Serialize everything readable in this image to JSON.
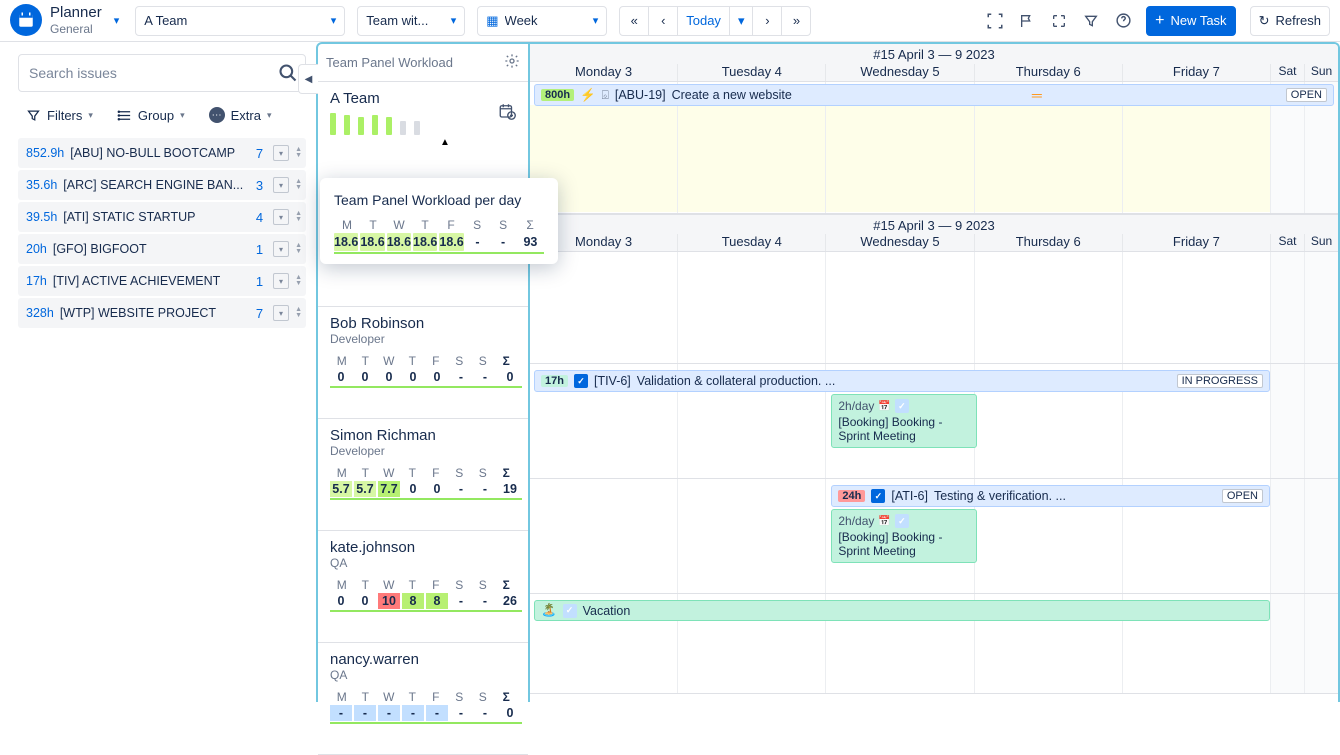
{
  "brand": {
    "title": "Planner",
    "subtitle": "General"
  },
  "toolbar": {
    "team_select": "A Team",
    "mode_select": "Team wit...",
    "range_select": "Week",
    "today": "Today",
    "new_task": "New Task",
    "refresh": "Refresh"
  },
  "search": {
    "placeholder": "Search issues"
  },
  "filters": {
    "filters": "Filters",
    "group": "Group",
    "extra": "Extra"
  },
  "projects": [
    {
      "h": "852.9h",
      "name": "[ABU] NO-BULL BOOTCAMP",
      "count": "7"
    },
    {
      "h": "35.6h",
      "name": "[ARC] SEARCH ENGINE BAN...",
      "count": "3"
    },
    {
      "h": "39.5h",
      "name": "[ATI] STATIC STARTUP",
      "count": "4"
    },
    {
      "h": "20h",
      "name": "[GFO] BIGFOOT",
      "count": "1"
    },
    {
      "h": "17h",
      "name": "[TIV] ACTIVE ACHIEVEMENT",
      "count": "1"
    },
    {
      "h": "328h",
      "name": "[WTP] WEBSITE PROJECT",
      "count": "7"
    }
  ],
  "panel": {
    "title": "Team Panel Workload",
    "team": "A Team",
    "tooltip_title": "Team Panel Workload per day",
    "days": [
      "M",
      "T",
      "W",
      "T",
      "F",
      "S",
      "S",
      "Σ"
    ],
    "team_vals": [
      "18.6",
      "18.6",
      "18.6",
      "18.6",
      "18.6",
      "-",
      "-",
      "93"
    ],
    "users": [
      {
        "name": "Bob Robinson",
        "role": "Developer",
        "vals": [
          "0",
          "0",
          "0",
          "0",
          "0",
          "-",
          "-",
          "0"
        ],
        "classes": [
          "",
          "",
          "",
          "",
          "",
          "",
          "",
          ""
        ]
      },
      {
        "name": "Simon Richman",
        "role": "Developer",
        "vals": [
          "5.7",
          "5.7",
          "7.7",
          "0",
          "0",
          "-",
          "-",
          "19"
        ],
        "classes": [
          "g",
          "g",
          "g2",
          "",
          "",
          "",
          "",
          ""
        ]
      },
      {
        "name": "kate.johnson",
        "role": "QA",
        "vals": [
          "0",
          "0",
          "10",
          "8",
          "8",
          "-",
          "-",
          "26"
        ],
        "classes": [
          "",
          "",
          "r",
          "g2",
          "g2",
          "",
          "",
          ""
        ]
      },
      {
        "name": "nancy.warren",
        "role": "QA",
        "vals": [
          "-",
          "-",
          "-",
          "-",
          "-",
          "-",
          "-",
          "0"
        ],
        "classes": [
          "b",
          "b",
          "b",
          "b",
          "b",
          "",
          "",
          ""
        ]
      }
    ]
  },
  "calendar": {
    "week_label": "#15 April 3 — 9 2023",
    "days": [
      "Monday 3",
      "Tuesday 4",
      "Wednesday 5",
      "Thursday 6",
      "Friday 7",
      "Sat",
      "Sun"
    ],
    "task1": {
      "h": "800h",
      "key": "[ABU-19]",
      "title": "Create a new website",
      "status": "OPEN"
    },
    "task2": {
      "h": "17h",
      "key": "[TIV-6]",
      "title": "Validation & collateral production. ...",
      "status": "IN PROGRESS"
    },
    "task3": {
      "h": "24h",
      "key": "[ATI-6]",
      "title": "Testing & verification. ...",
      "status": "OPEN"
    },
    "booking": {
      "h": "2h/day",
      "title": "[Booking] Booking - Sprint Meeting"
    },
    "vacation": "Vacation"
  }
}
